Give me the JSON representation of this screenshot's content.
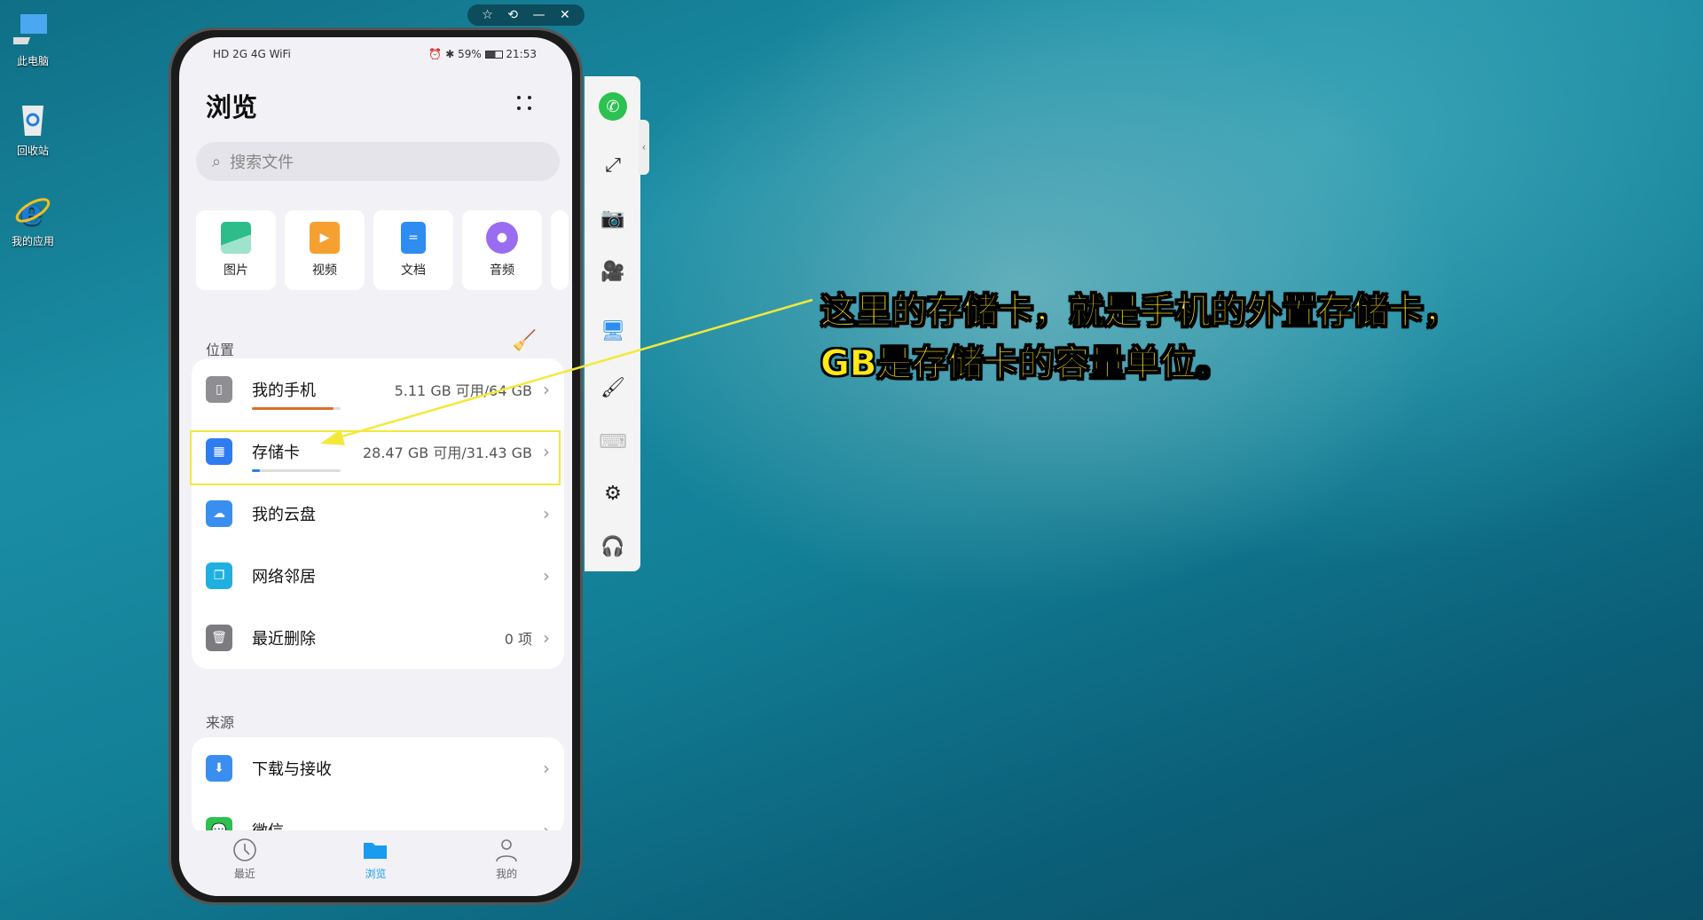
{
  "desktop": {
    "icons": [
      {
        "label": "此电脑",
        "icon": "computer-icon"
      },
      {
        "label": "回收站",
        "icon": "recycle-bin-icon"
      },
      {
        "label": "我的应用",
        "icon": "ie-icon"
      }
    ]
  },
  "window_controls": [
    "pin-icon",
    "rotate-icon",
    "minimize-icon",
    "close-icon"
  ],
  "phone": {
    "status": {
      "left": "HD 2G 4G WiFi",
      "battery": "59%",
      "time": "21:53"
    },
    "title": "浏览",
    "search": {
      "placeholder": "搜索文件"
    },
    "categories": [
      {
        "label": "图片",
        "color": "#2dbd8b"
      },
      {
        "label": "视频",
        "color": "#f5a030"
      },
      {
        "label": "文档",
        "color": "#2f8cf0"
      },
      {
        "label": "音频",
        "color": "#9a6cf0"
      }
    ],
    "location": {
      "header": "位置",
      "rows": [
        {
          "label": "我的手机",
          "value": "5.11 GB 可用/64 GB",
          "usage": 0.92,
          "bar_color": "#d9702a"
        },
        {
          "label": "存储卡",
          "value": "28.47 GB 可用/31.43 GB",
          "usage": 0.094,
          "bar_color": "#2f7cf0"
        },
        {
          "label": "我的云盘",
          "value": ""
        },
        {
          "label": "网络邻居",
          "value": ""
        },
        {
          "label": "最近删除",
          "value": "0 项"
        }
      ]
    },
    "source": {
      "header": "来源",
      "rows": [
        {
          "label": "下载与接收"
        },
        {
          "label": "微信"
        }
      ]
    },
    "nav": [
      {
        "label": "最近",
        "active": false
      },
      {
        "label": "浏览",
        "active": true
      },
      {
        "label": "我的",
        "active": false
      }
    ]
  },
  "sidebar": [
    "whatsapp-icon",
    "fullscreen-icon",
    "screenshot-icon",
    "record-icon",
    "screen-cast-icon",
    "brush-icon",
    "keyboard-icon",
    "settings-icon",
    "headset-icon"
  ],
  "annotation": {
    "line1": "这里的存储卡，就是手机的外置存储卡，",
    "line2": "GB是存储卡的容量单位。",
    "color": "#ffe916"
  }
}
